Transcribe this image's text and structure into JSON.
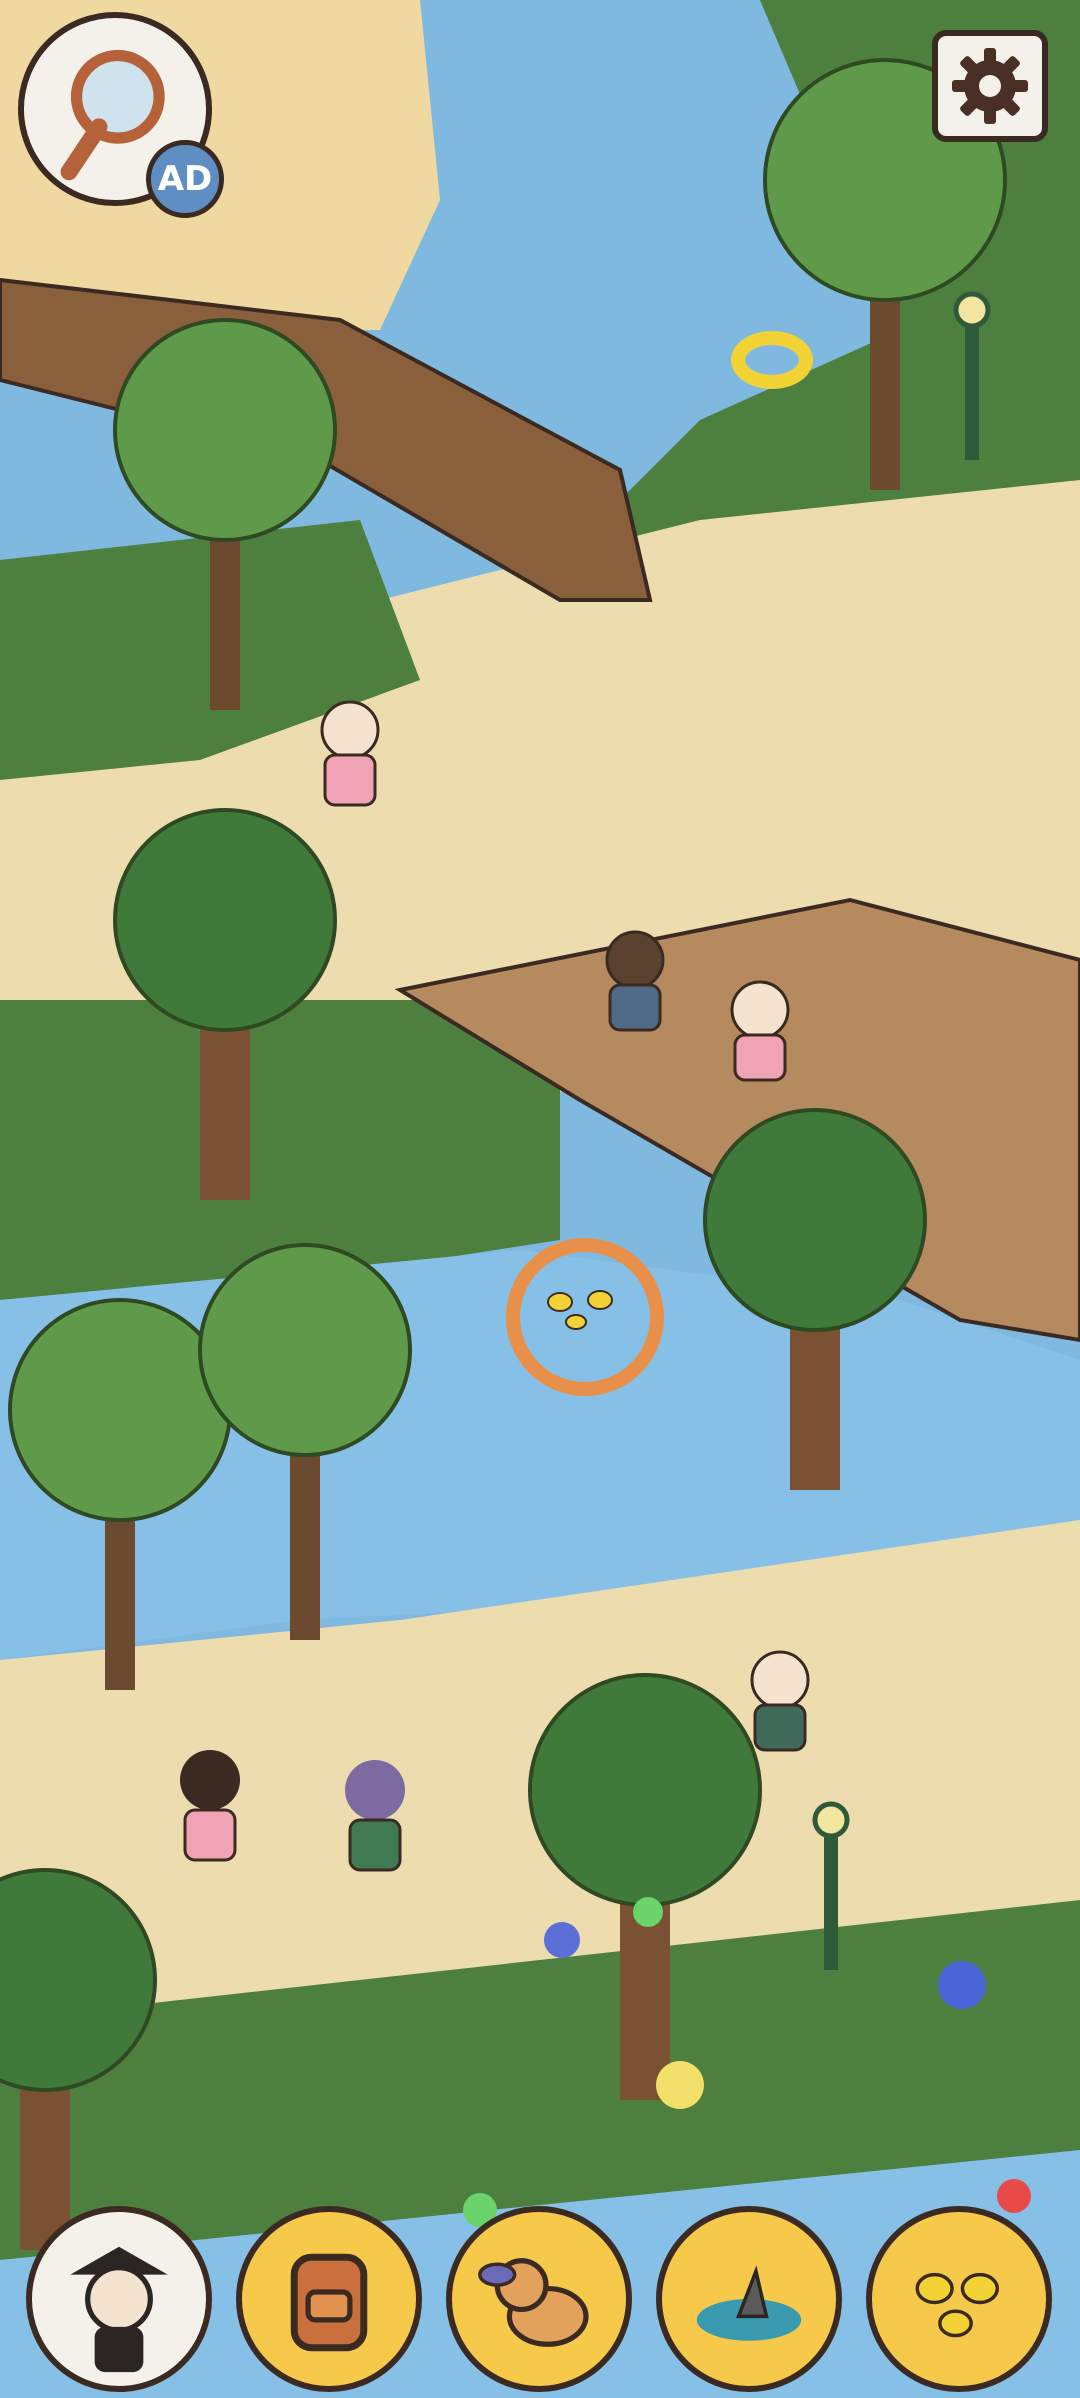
{
  "hud": {
    "hint_button": {
      "icon": "magnifier-icon",
      "badge_text": "AD"
    },
    "settings_button": {
      "icon": "gear-icon"
    }
  },
  "game": {
    "target_marker": {
      "icon": "ducklings-icon"
    },
    "scene": {
      "sign_text": ""
    }
  },
  "items_tray": [
    {
      "name": "pirate-character",
      "icon": "pirate-icon",
      "found": true
    },
    {
      "name": "backpack",
      "icon": "backpack-icon",
      "found": false
    },
    {
      "name": "dog-with-frisbee",
      "icon": "dog-icon",
      "found": false
    },
    {
      "name": "shark-fin",
      "icon": "shark-icon",
      "found": false
    },
    {
      "name": "ducklings",
      "icon": "ducklings-icon",
      "found": false
    }
  ],
  "colors": {
    "water": "#7fb9e0",
    "sand": "#eddcae",
    "grass": "#4d7f3e",
    "tray_gold": "#f6c94a",
    "tray_found": "#f4f1ea",
    "target_ring": "#e8904a",
    "outline": "#3b2a22"
  }
}
